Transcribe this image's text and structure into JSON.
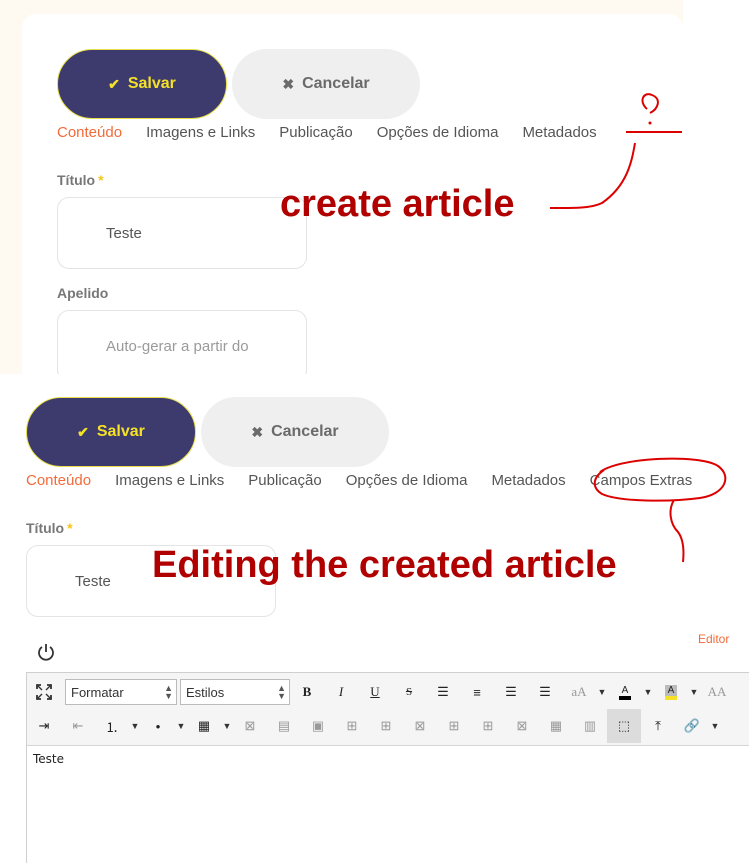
{
  "top": {
    "save_label": "Salvar",
    "cancel_label": "Cancelar",
    "tabs": [
      "Conteúdo",
      "Imagens e Links",
      "Publicação",
      "Opções de Idioma",
      "Metadados"
    ],
    "title_label": "Título",
    "title_value": "Teste",
    "alias_label": "Apelido",
    "alias_placeholder": "Auto-gerar a partir do",
    "annotation": "create article",
    "question_mark": "?"
  },
  "bottom": {
    "save_label": "Salvar",
    "cancel_label": "Cancelar",
    "tabs": [
      "Conteúdo",
      "Imagens e Links",
      "Publicação",
      "Opções de Idioma",
      "Metadados",
      "Campos Extras"
    ],
    "title_label": "Título",
    "title_value": "Teste",
    "annotation": "Editing the created article",
    "editor_toggle_label": "Editor",
    "format_select": "Formatar",
    "styles_select": "Estilos",
    "content": "Teste"
  },
  "colors": {
    "save_bg": "#3d3a6e",
    "save_text": "#f5e126",
    "active_tab": "#f26b3a",
    "annotation": "#b00000",
    "required_star": "#f5c518"
  },
  "icons": {
    "save": "check-icon",
    "cancel": "x-icon",
    "toggle": "power-icon",
    "fullscreen": "fullscreen-icon"
  }
}
